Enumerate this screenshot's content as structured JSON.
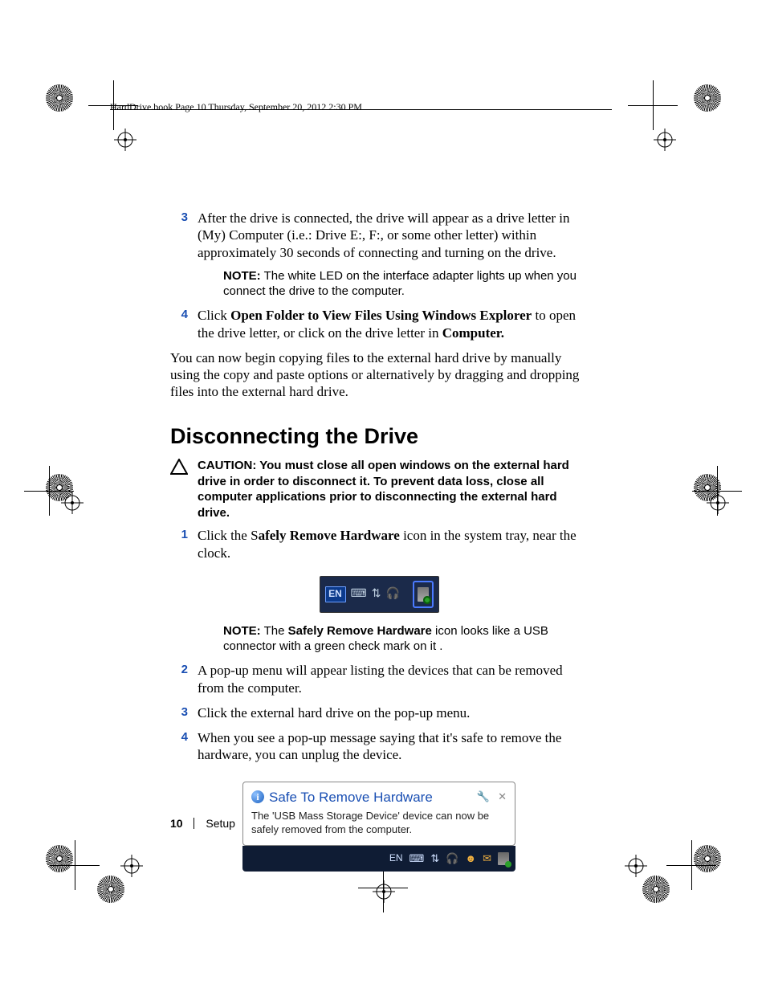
{
  "header": {
    "running_head": "HardDrive.book  Page 10  Thursday, September 20, 2012  2:30 PM"
  },
  "steps_a": [
    {
      "num": "3",
      "text": "After the drive is connected, the drive will appear as a drive letter in (My) Computer (i.e.: Drive E:, F:, or some other letter) within approximately 30 seconds of connecting and turning on the drive."
    }
  ],
  "note1": {
    "label": "NOTE:",
    "text": " The white LED on the interface adapter lights up when you connect the drive to the computer."
  },
  "step4": {
    "num": "4",
    "pre": "Click ",
    "bold": "Open Folder to View Files Using Windows Explorer",
    "mid": " to open the drive letter, or click on the drive letter in ",
    "bold2": "Computer."
  },
  "para1": "You can now begin copying files to the external hard drive by manually using the copy and paste options or alternatively by dragging and dropping files into the external hard drive.",
  "section_heading": "Disconnecting the Drive",
  "caution": {
    "label": "CAUTION:",
    "text": " You must close all open windows on the external hard drive in order to disconnect it. To prevent data loss, close all computer applications prior to disconnecting the external hard drive."
  },
  "steps_b": [
    {
      "num": "1",
      "pre": "Click the S",
      "bold": "afely Remove Hardware",
      "post": " icon in the system tray, near the clock."
    }
  ],
  "tray": {
    "lang": "EN"
  },
  "note2": {
    "label": "NOTE:",
    "pre": " The ",
    "bold": "Safely Remove Hardware",
    "post": " icon looks like a USB connector with a green check mark on it ."
  },
  "steps_c": [
    {
      "num": "2",
      "text": "A pop-up menu will appear listing the devices that can be removed from the computer."
    },
    {
      "num": "3",
      "text": "Click the external hard drive on the pop-up menu."
    },
    {
      "num": "4",
      "text": "When you see a pop-up message saying that it's safe to remove the hardware, you can unplug the device."
    }
  ],
  "balloon": {
    "title": "Safe To Remove Hardware",
    "body": "The 'USB Mass Storage Device' device can now be safely removed from the computer.",
    "lang": "EN"
  },
  "footer": {
    "page": "10",
    "section": "Setup"
  }
}
